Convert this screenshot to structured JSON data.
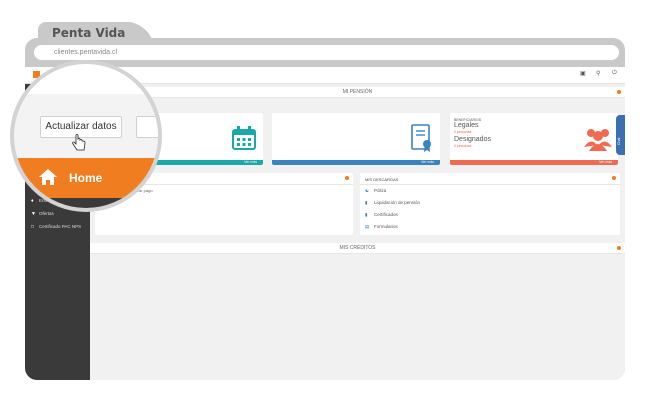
{
  "browser": {
    "tab_title": "Penta Vida",
    "url": "clientes.pentavida.cl"
  },
  "topbar": {
    "icons": [
      "screen-icon",
      "key-icon",
      "power-icon"
    ]
  },
  "sidebar": {
    "items": [
      {
        "label": "Entrenamiento",
        "icon": "handshake-icon"
      },
      {
        "label": "Ofertas",
        "icon": "tag-icon"
      },
      {
        "label": "Certificado PAC NPS",
        "icon": "certificate-icon"
      }
    ]
  },
  "main": {
    "section_pension": "MI PENSIÓN",
    "section_creditos": "MIS CRÉDITOS",
    "cards": [
      {
        "footer": "Ver más",
        "color": "#1aa8a8"
      },
      {
        "footer": "Ver más",
        "color": "#3b83c0"
      },
      {
        "footer": "Ver más",
        "color": "#ef6a50"
      }
    ],
    "beneficiarios": {
      "heading": "BENEFICIARIOS",
      "legales_label": "Legales",
      "legales_sub": "0 personas",
      "designados_label": "Designados",
      "designados_sub": "0 personas"
    },
    "side_tab_label": "Chat",
    "panel_left_text": "Actualizar pago",
    "descargas": {
      "heading": "MIS DESCARGAS",
      "items": [
        "Póliza",
        "Liquidación de pensión",
        "Certificados",
        "Formularios"
      ]
    }
  },
  "magnifier": {
    "button_label": "Actualizar datos",
    "home_label": "Home"
  },
  "colors": {
    "accent": "#f07d20",
    "sidebar": "#3a3a3a",
    "teal": "#1aa8a8",
    "blue": "#3b83c0",
    "coral": "#ef6a50"
  }
}
